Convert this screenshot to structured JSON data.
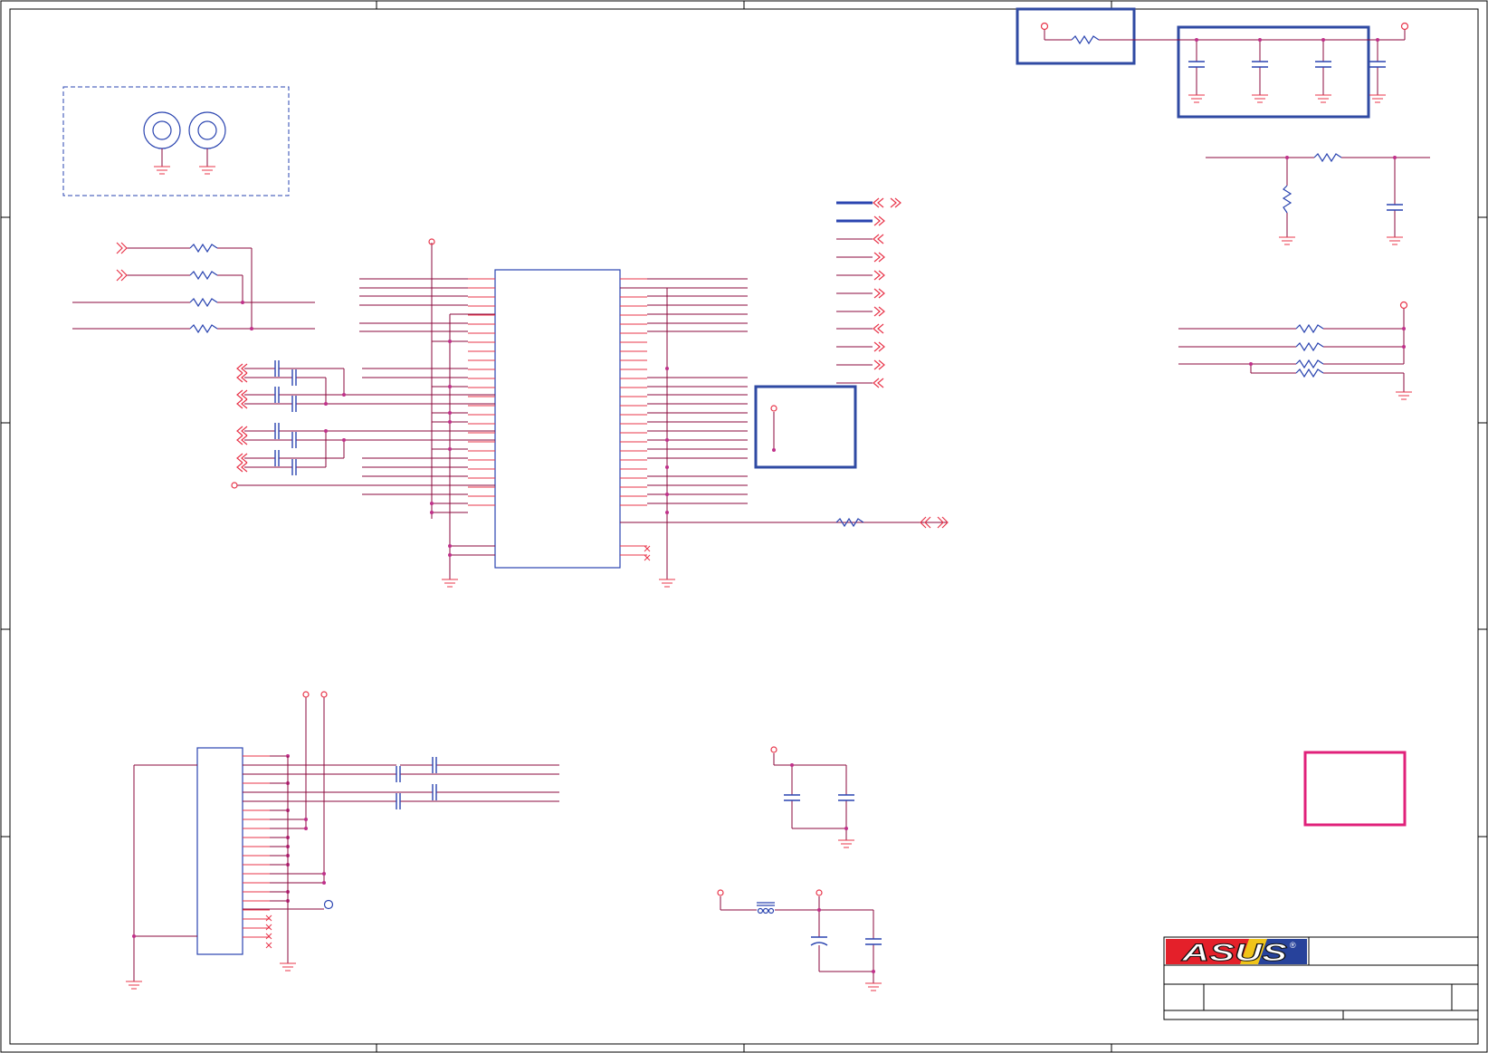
{
  "sheet": {
    "title_block": {
      "logo": "ASUS",
      "logo_mark": "®"
    }
  },
  "colors": {
    "frame": "#000000",
    "wire": "#8b0a3c",
    "pin": "#e8354a",
    "component": "#2a44b0",
    "box": "#2f4aa3",
    "note_box": "#e0217a",
    "junction": "#c0308a",
    "logo_red": "#e4202a",
    "logo_blue": "#27429b"
  }
}
